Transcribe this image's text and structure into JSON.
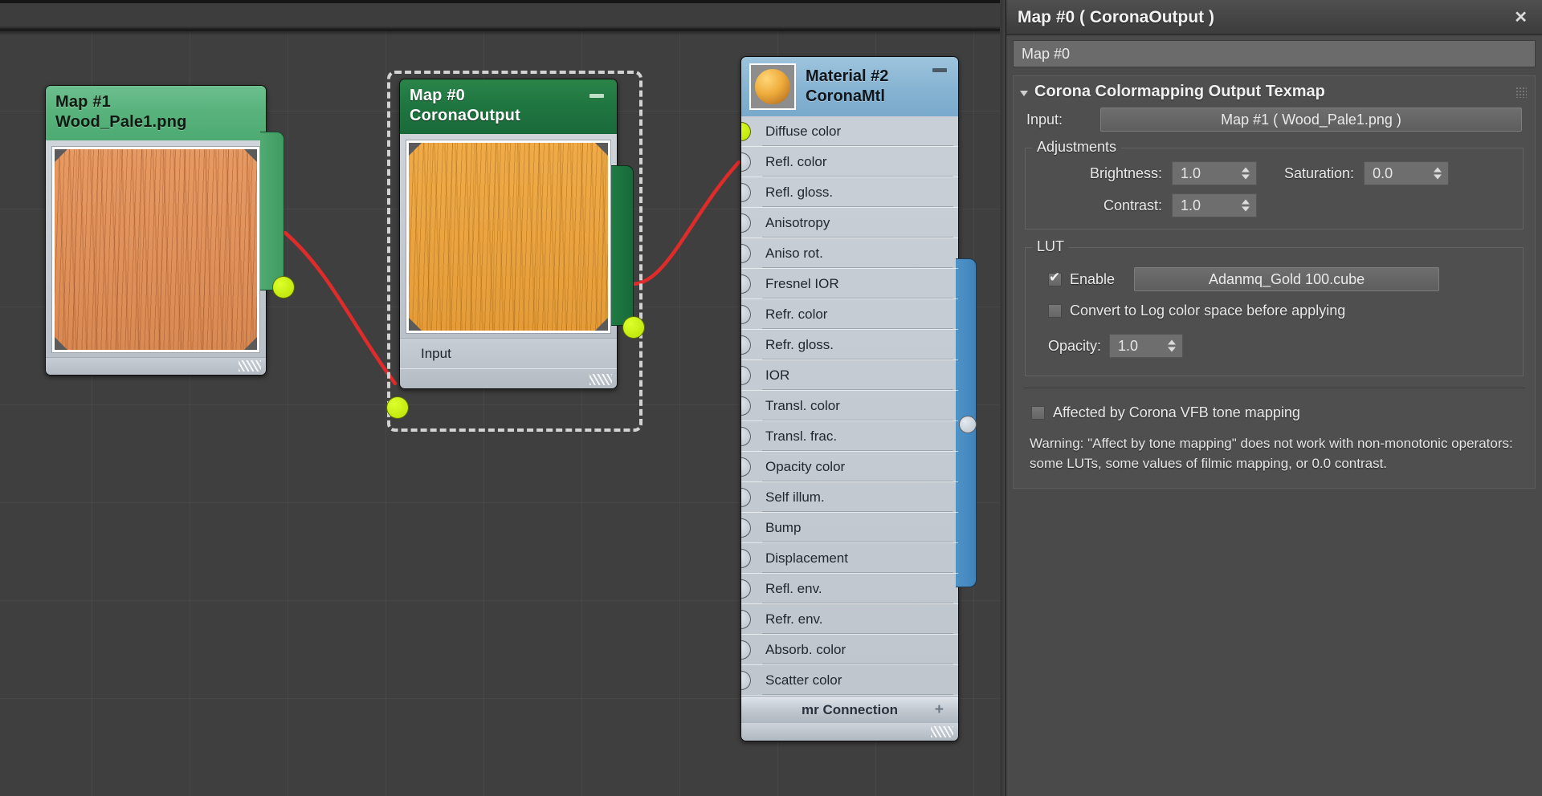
{
  "graph": {
    "nodes": [
      {
        "id": "map1",
        "title": "Map #1",
        "subtitle": "Wood_Pale1.png",
        "selected": false,
        "output_socket": "output-socket"
      },
      {
        "id": "map0",
        "title": "Map #0",
        "subtitle": "CoronaOutput",
        "selected": true,
        "collapse_label": "–",
        "input_socket_label": "Input",
        "output_socket": "output-socket"
      },
      {
        "id": "material2",
        "title": "Material #2",
        "subtitle": "CoronaMtl",
        "collapse_label": "–",
        "sockets": [
          "Diffuse color",
          "Refl. color",
          "Refl. gloss.",
          "Anisotropy",
          "Aniso rot.",
          "Fresnel IOR",
          "Refr. color",
          "Refr. gloss.",
          "IOR",
          "Transl. color",
          "Transl. frac.",
          "Opacity color",
          "Self illum.",
          "Bump",
          "Displacement",
          "Refl. env.",
          "Refr. env.",
          "Absorb. color",
          "Scatter color"
        ],
        "connected_socket_index": 0,
        "mr_connection_label": "mr Connection",
        "mr_connection_plus": "+"
      }
    ],
    "wire_color": "#e02b2b",
    "socket_connected_color": "#c8ef14"
  },
  "panel": {
    "titlebar": {
      "title": "Map #0  ( CoronaOutput )",
      "close_label": "✕"
    },
    "name_field": {
      "value": "Map #0"
    },
    "rollout": {
      "title": "Corona Colormapping Output Texmap",
      "expanded": true,
      "input": {
        "label": "Input:",
        "value": "Map #1  ( Wood_Pale1.png )"
      },
      "adjustments": {
        "group_label": "Adjustments",
        "brightness": {
          "label": "Brightness:",
          "value": "1.0"
        },
        "saturation": {
          "label": "Saturation:",
          "value": "0.0"
        },
        "contrast": {
          "label": "Contrast:",
          "value": "1.0"
        }
      },
      "lut": {
        "group_label": "LUT",
        "enable": {
          "label": "Enable",
          "checked": true
        },
        "file": "Adanmq_Gold 100.cube",
        "convert_log": {
          "label": "Convert to Log color space before applying",
          "checked": false
        },
        "opacity": {
          "label": "Opacity:",
          "value": "1.0"
        }
      },
      "tone_mapping": {
        "label": "Affected by Corona VFB tone mapping",
        "checked": false
      },
      "warning": "Warning: \"Affect by tone mapping\" does not work with non-monotonic operators: some LUTs, some values of filmic mapping, or 0.0 contrast."
    }
  },
  "colors": {
    "accent_green": "#1f7540",
    "accent_blue": "#86b3d2",
    "wire_red": "#e02b2b",
    "socket_yellow": "#c8ef14",
    "panel_bg": "#4a4a4a",
    "graph_bg": "#3f3f3f"
  }
}
